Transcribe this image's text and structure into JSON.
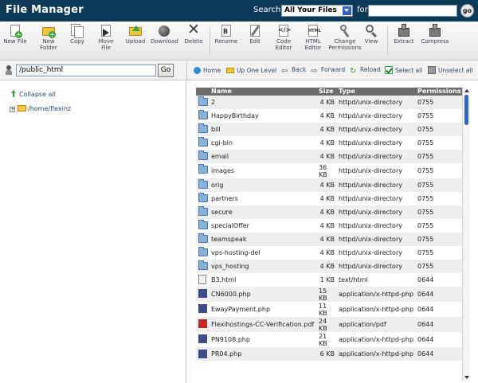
{
  "titlebar": {
    "title": "File Manager",
    "search_label": "Search",
    "search_scope": "All Your Files",
    "for_label": "for",
    "search_value": "",
    "go_label": "go"
  },
  "toolbar": [
    {
      "id": "new-file",
      "label": "New File",
      "icon": "new-file-icon"
    },
    {
      "id": "new-folder",
      "label": "New\nFolder",
      "icon": "new-folder-icon"
    },
    {
      "id": "copy",
      "label": "Copy",
      "icon": "copy-icon"
    },
    {
      "id": "move-file",
      "label": "Move\nFile",
      "icon": "move-icon"
    },
    {
      "id": "upload",
      "label": "Upload",
      "icon": "upload-icon"
    },
    {
      "id": "download",
      "label": "Download",
      "icon": "download-icon"
    },
    {
      "id": "delete",
      "label": "Delete",
      "icon": "delete-icon"
    },
    {
      "id": "rename",
      "label": "Rename",
      "icon": "rename-icon"
    },
    {
      "id": "edit",
      "label": "Edit",
      "icon": "edit-icon"
    },
    {
      "id": "code-editor",
      "label": "Code\nEditor",
      "icon": "code-editor-icon"
    },
    {
      "id": "html-editor",
      "label": "HTML\nEditor",
      "icon": "html-editor-icon"
    },
    {
      "id": "change-permissions",
      "label": "Change\nPermissions",
      "icon": "permissions-icon"
    },
    {
      "id": "view",
      "label": "View",
      "icon": "view-icon"
    },
    {
      "id": "extract",
      "label": "Extract",
      "icon": "extract-icon"
    },
    {
      "id": "compress",
      "label": "Compress",
      "icon": "compress-icon"
    }
  ],
  "pathbar": {
    "path": "/public_html",
    "go_label": "Go",
    "home": "Home",
    "up_one_level": "Up One Level",
    "back": "Back",
    "forward": "Forward",
    "reload": "Reload",
    "select_all": "Select all",
    "unselect_all": "Unselect all"
  },
  "tree": {
    "collapse_all": "Collapse all",
    "root": "/home/flexinz"
  },
  "columns": {
    "name": "Name",
    "size": "Size",
    "type": "Type",
    "permissions": "Permissions"
  },
  "files": [
    {
      "name": "2",
      "size": "4 KB",
      "type": "httpd/unix-directory",
      "perm": "0755",
      "kind": "dir"
    },
    {
      "name": "HappyBirthday",
      "size": "4 KB",
      "type": "httpd/unix-directory",
      "perm": "0755",
      "kind": "dir"
    },
    {
      "name": "bill",
      "size": "4 KB",
      "type": "httpd/unix-directory",
      "perm": "0755",
      "kind": "dir"
    },
    {
      "name": "cgi-bin",
      "size": "4 KB",
      "type": "httpd/unix-directory",
      "perm": "0755",
      "kind": "dir"
    },
    {
      "name": "email",
      "size": "4 KB",
      "type": "httpd/unix-directory",
      "perm": "0755",
      "kind": "dir"
    },
    {
      "name": "images",
      "size": "36 KB",
      "type": "httpd/unix-directory",
      "perm": "0755",
      "kind": "dir"
    },
    {
      "name": "orig",
      "size": "4 KB",
      "type": "httpd/unix-directory",
      "perm": "0755",
      "kind": "dir"
    },
    {
      "name": "partners",
      "size": "4 KB",
      "type": "httpd/unix-directory",
      "perm": "0755",
      "kind": "dir"
    },
    {
      "name": "secure",
      "size": "4 KB",
      "type": "httpd/unix-directory",
      "perm": "0755",
      "kind": "dir"
    },
    {
      "name": "specialOffer",
      "size": "4 KB",
      "type": "httpd/unix-directory",
      "perm": "0755",
      "kind": "dir"
    },
    {
      "name": "teamspeak",
      "size": "4 KB",
      "type": "httpd/unix-directory",
      "perm": "0755",
      "kind": "dir"
    },
    {
      "name": "vps-hosting-del",
      "size": "4 KB",
      "type": "httpd/unix-directory",
      "perm": "0755",
      "kind": "dir"
    },
    {
      "name": "vps_hosting",
      "size": "4 KB",
      "type": "httpd/unix-directory",
      "perm": "0755",
      "kind": "dir"
    },
    {
      "name": "B3.html",
      "size": "1 KB",
      "type": "text/html",
      "perm": "0644",
      "kind": "html"
    },
    {
      "name": "CN6000.php",
      "size": "15 KB",
      "type": "application/x-httpd-php",
      "perm": "0644",
      "kind": "php"
    },
    {
      "name": "EwayPayment.php",
      "size": "11 KB",
      "type": "application/x-httpd-php",
      "perm": "0644",
      "kind": "php"
    },
    {
      "name": "Flexihostings-CC-Verification.pdf",
      "size": "24 KB",
      "type": "application/pdf",
      "perm": "0644",
      "kind": "pdf"
    },
    {
      "name": "PN9108.php",
      "size": "21 KB",
      "type": "application/x-httpd-php",
      "perm": "0644",
      "kind": "php"
    },
    {
      "name": "PR04.php",
      "size": "6 KB",
      "type": "application/x-httpd-php",
      "perm": "0644",
      "kind": "php"
    }
  ]
}
